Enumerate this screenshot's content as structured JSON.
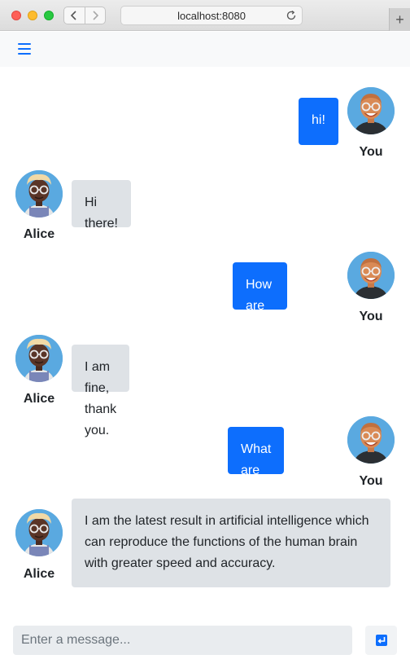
{
  "browser": {
    "url": "localhost:8080",
    "new_tab_label": "+"
  },
  "colors": {
    "primary": "#0d6efd",
    "incoming_bubble": "#dee2e6",
    "avatar_bg": "#5aa9e0"
  },
  "messages": [
    {
      "sender": "You",
      "text": "hi!"
    },
    {
      "sender": "Alice",
      "text": "Hi there!"
    },
    {
      "sender": "You",
      "text": "How are you?"
    },
    {
      "sender": "Alice",
      "text": "I am fine, thank you."
    },
    {
      "sender": "You",
      "text": "What are you?"
    },
    {
      "sender": "Alice",
      "text": "I am the latest result in artificial intelligence which can reproduce the functions of the human brain with greater speed and accuracy."
    }
  ],
  "composer": {
    "placeholder": "Enter a message...",
    "send_icon": "enter-icon"
  }
}
